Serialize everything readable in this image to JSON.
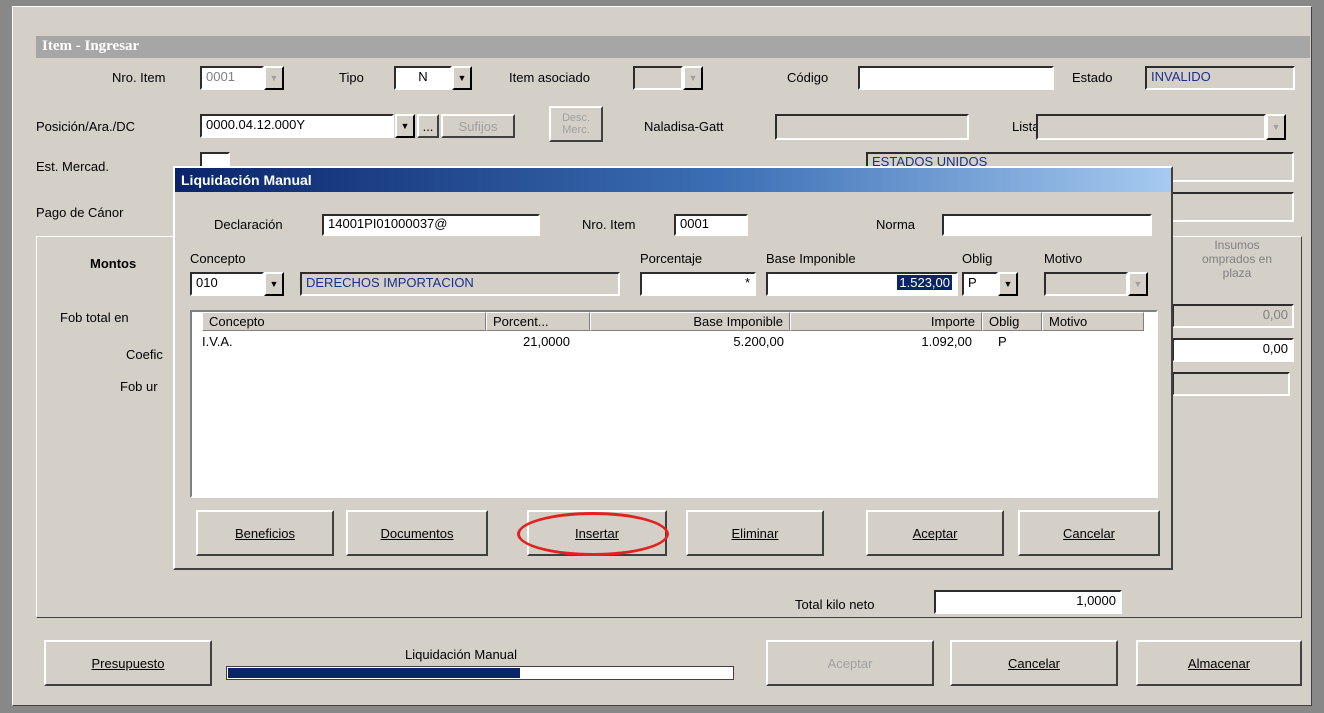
{
  "main": {
    "title": "Item - Ingresar",
    "nro_item_label": "Nro. Item",
    "nro_item_value": "0001",
    "tipo_label": "Tipo",
    "tipo_value": "N",
    "item_asociado_label": "Item asociado",
    "codigo_label": "Código",
    "codigo_value": "",
    "estado_label": "Estado",
    "estado_value": "INVALIDO",
    "posicion_label": "Posición/Ara./DC",
    "posicion_value": "0000.04.12.000Y",
    "ellipsis_btn": "...",
    "sufijos_btn": "Sufijos",
    "desc_merc_btn_line1": "Desc.",
    "desc_merc_btn_line2": "Merc.",
    "naladisa_label": "Naladisa-Gatt",
    "lista_label": "Lista",
    "est_mercad_label": "Est. Mercad.",
    "pais_value": "ESTADOS UNIDOS",
    "pago_canon_label": "Pago de Cánor",
    "tab_montos": "Montos",
    "tab_insumos_l1": "Insumos",
    "tab_insumos_l2": "omprados en",
    "tab_insumos_l3": "plaza",
    "fob_total_label": "Fob total en",
    "coef_label": "Coefic",
    "fob_unit_label": "Fob ur",
    "right_value_1": "0,00",
    "right_value_2": "0,00",
    "total_kilo_label": "Total kilo neto",
    "total_kilo_value": "1,0000",
    "presupuesto_btn": "Presupuesto",
    "progress_label": "Liquidación Manual",
    "progress_fraction": 0.58,
    "aceptar_btn": "Aceptar",
    "cancelar_btn": "Cancelar",
    "almacenar_btn": "Almacenar"
  },
  "dialog": {
    "title": "Liquidación Manual",
    "declaracion_label": "Declaración",
    "declaracion_value": "14001PI01000037@",
    "nro_item_label": "Nro. Item",
    "nro_item_value": "0001",
    "norma_label": "Norma",
    "norma_value": "",
    "concepto_label": "Concepto",
    "concepto_code": "010",
    "concepto_desc": "DERECHOS IMPORTACION",
    "porcentaje_label": "Porcentaje",
    "porcentaje_value": "*",
    "base_label": "Base Imponible",
    "base_value": "1.523,00",
    "oblig_label": "Oblig",
    "oblig_value": "P",
    "motivo_label": "Motivo",
    "grid_headers": [
      "Concepto",
      "Porcent...",
      "Base Imponible",
      "Importe",
      "Oblig",
      "Motivo"
    ],
    "grid_rows": [
      [
        "I.V.A.",
        "21,0000",
        "5.200,00",
        "1.092,00",
        "P",
        ""
      ]
    ],
    "buttons": {
      "beneficios": "Beneficios",
      "documentos": "Documentos",
      "insertar": "Insertar",
      "eliminar": "Eliminar",
      "aceptar": "Aceptar",
      "cancelar": "Cancelar"
    }
  },
  "colors": {
    "title_gradient_start": "#0a246a",
    "highlight": "#0a246a",
    "annotation_red": "#e3221f"
  }
}
